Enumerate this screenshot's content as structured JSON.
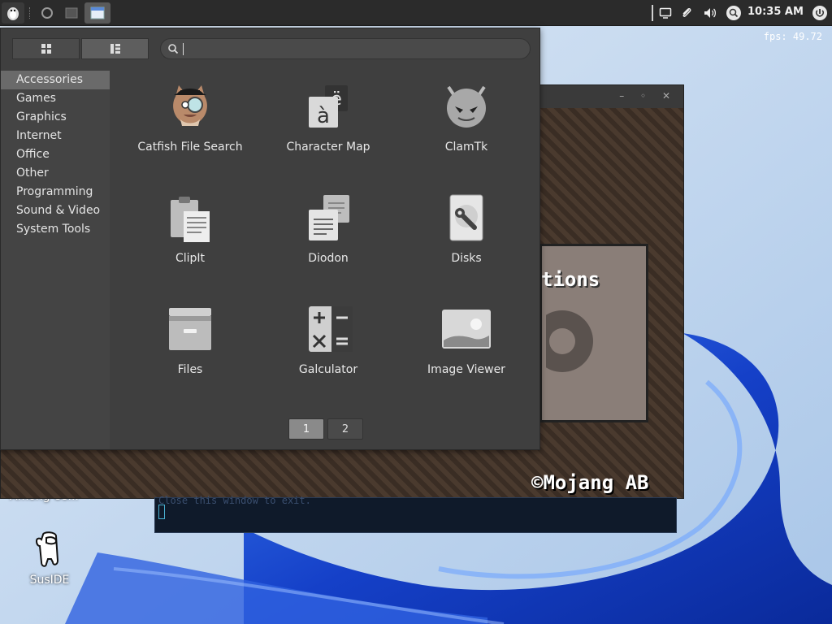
{
  "panel": {
    "clock": "10:35 AM"
  },
  "desktop": {
    "among_us_label": "Among Us...",
    "susIDE_label": "SusIDE"
  },
  "minecraft": {
    "fps": "fps: 49.72",
    "options_text": "tions",
    "copyright": "©Mojang AB"
  },
  "terminal": {
    "text": "Close this window to exit."
  },
  "menu": {
    "search": {
      "placeholder": "",
      "value": ""
    },
    "categories": [
      {
        "label": "Accessories",
        "active": true
      },
      {
        "label": "Games"
      },
      {
        "label": "Graphics"
      },
      {
        "label": "Internet"
      },
      {
        "label": "Office"
      },
      {
        "label": "Other"
      },
      {
        "label": "Programming"
      },
      {
        "label": "Sound & Video"
      },
      {
        "label": "System Tools"
      }
    ],
    "apps": [
      {
        "label": "Catfish File Search",
        "icon": "catfish-icon"
      },
      {
        "label": "Character Map",
        "icon": "character-map-icon"
      },
      {
        "label": "ClamTk",
        "icon": "clamtk-icon"
      },
      {
        "label": "ClipIt",
        "icon": "clipit-icon"
      },
      {
        "label": "Diodon",
        "icon": "diodon-icon"
      },
      {
        "label": "Disks",
        "icon": "disks-icon"
      },
      {
        "label": "Files",
        "icon": "files-icon"
      },
      {
        "label": "Galculator",
        "icon": "galculator-icon"
      },
      {
        "label": "Image Viewer",
        "icon": "image-viewer-icon"
      }
    ],
    "pages": [
      {
        "label": "1",
        "active": true
      },
      {
        "label": "2"
      }
    ]
  },
  "colors": {
    "menu_bg": "#3f3f3f",
    "category_active": "#6a6a6a",
    "panel_bg": "#2b2b2b",
    "wallpaper_blue": "#1f4fd8"
  }
}
